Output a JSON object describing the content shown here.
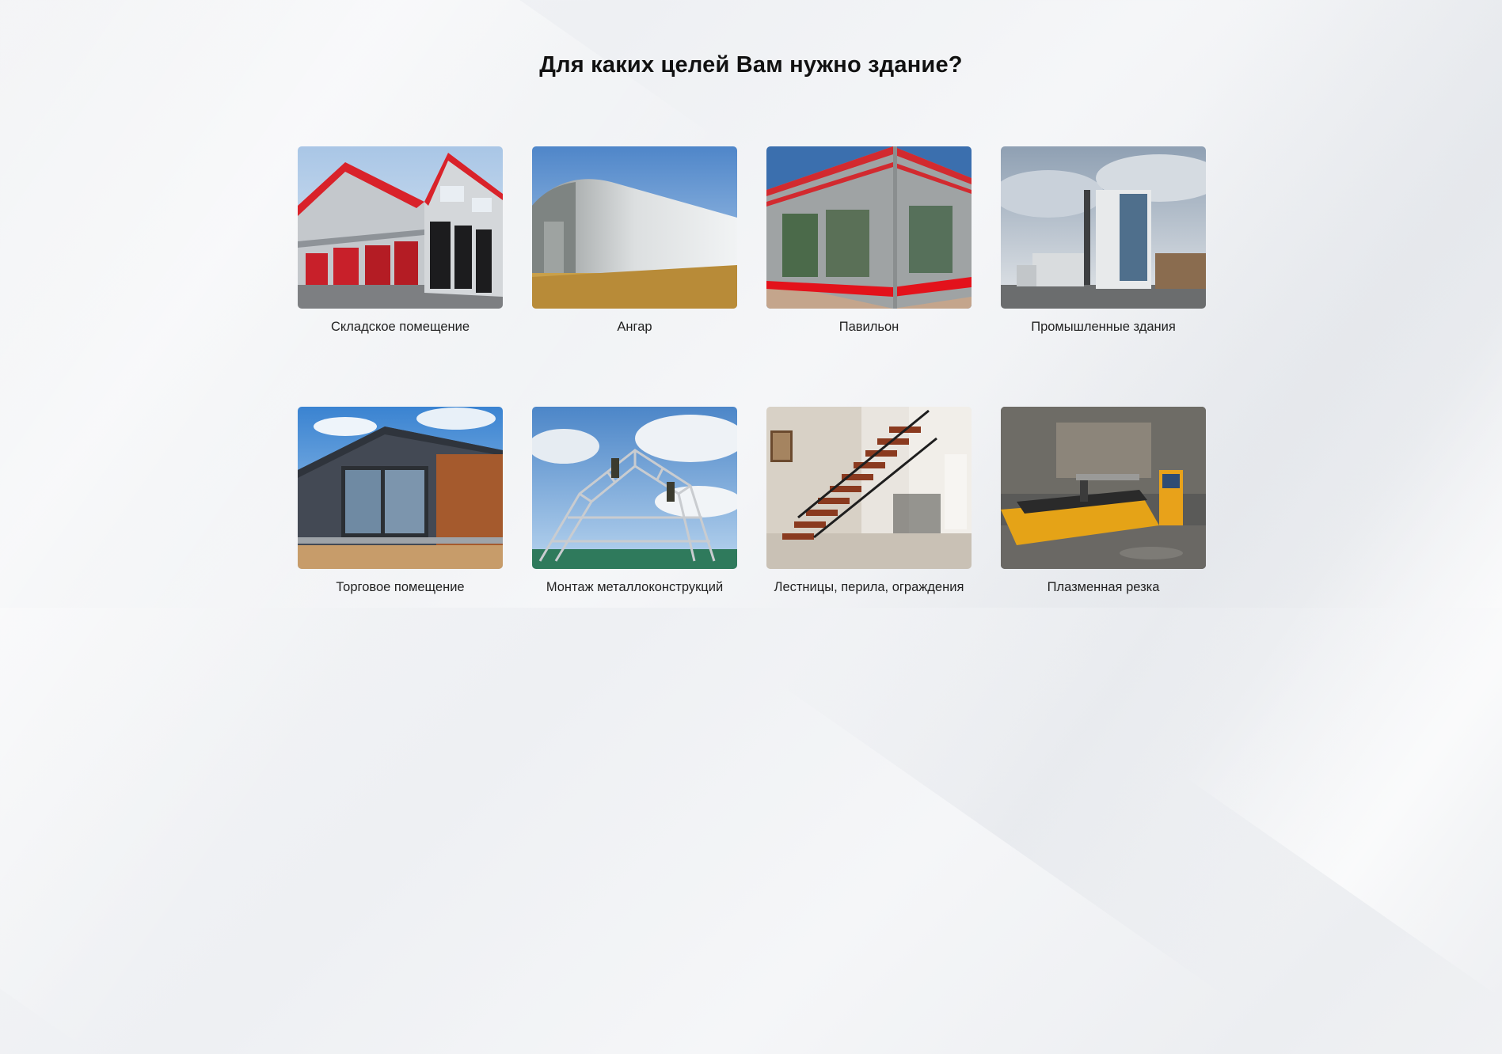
{
  "section": {
    "title": "Для каких целей Вам нужно здание?"
  },
  "cards": [
    {
      "label": "Складское помещение",
      "icon": "warehouse-photo"
    },
    {
      "label": "Ангар",
      "icon": "hangar-photo"
    },
    {
      "label": "Павильон",
      "icon": "pavilion-photo"
    },
    {
      "label": "Промышленные здания",
      "icon": "industrial-building-photo"
    },
    {
      "label": "Торговое помещение",
      "icon": "retail-space-photo"
    },
    {
      "label": "Монтаж металлоконструкций",
      "icon": "steel-assembly-photo"
    },
    {
      "label": "Лестницы, перила, ограждения",
      "icon": "stairs-railings-photo"
    },
    {
      "label": "Плазменная резка",
      "icon": "plasma-cutting-photo"
    }
  ]
}
